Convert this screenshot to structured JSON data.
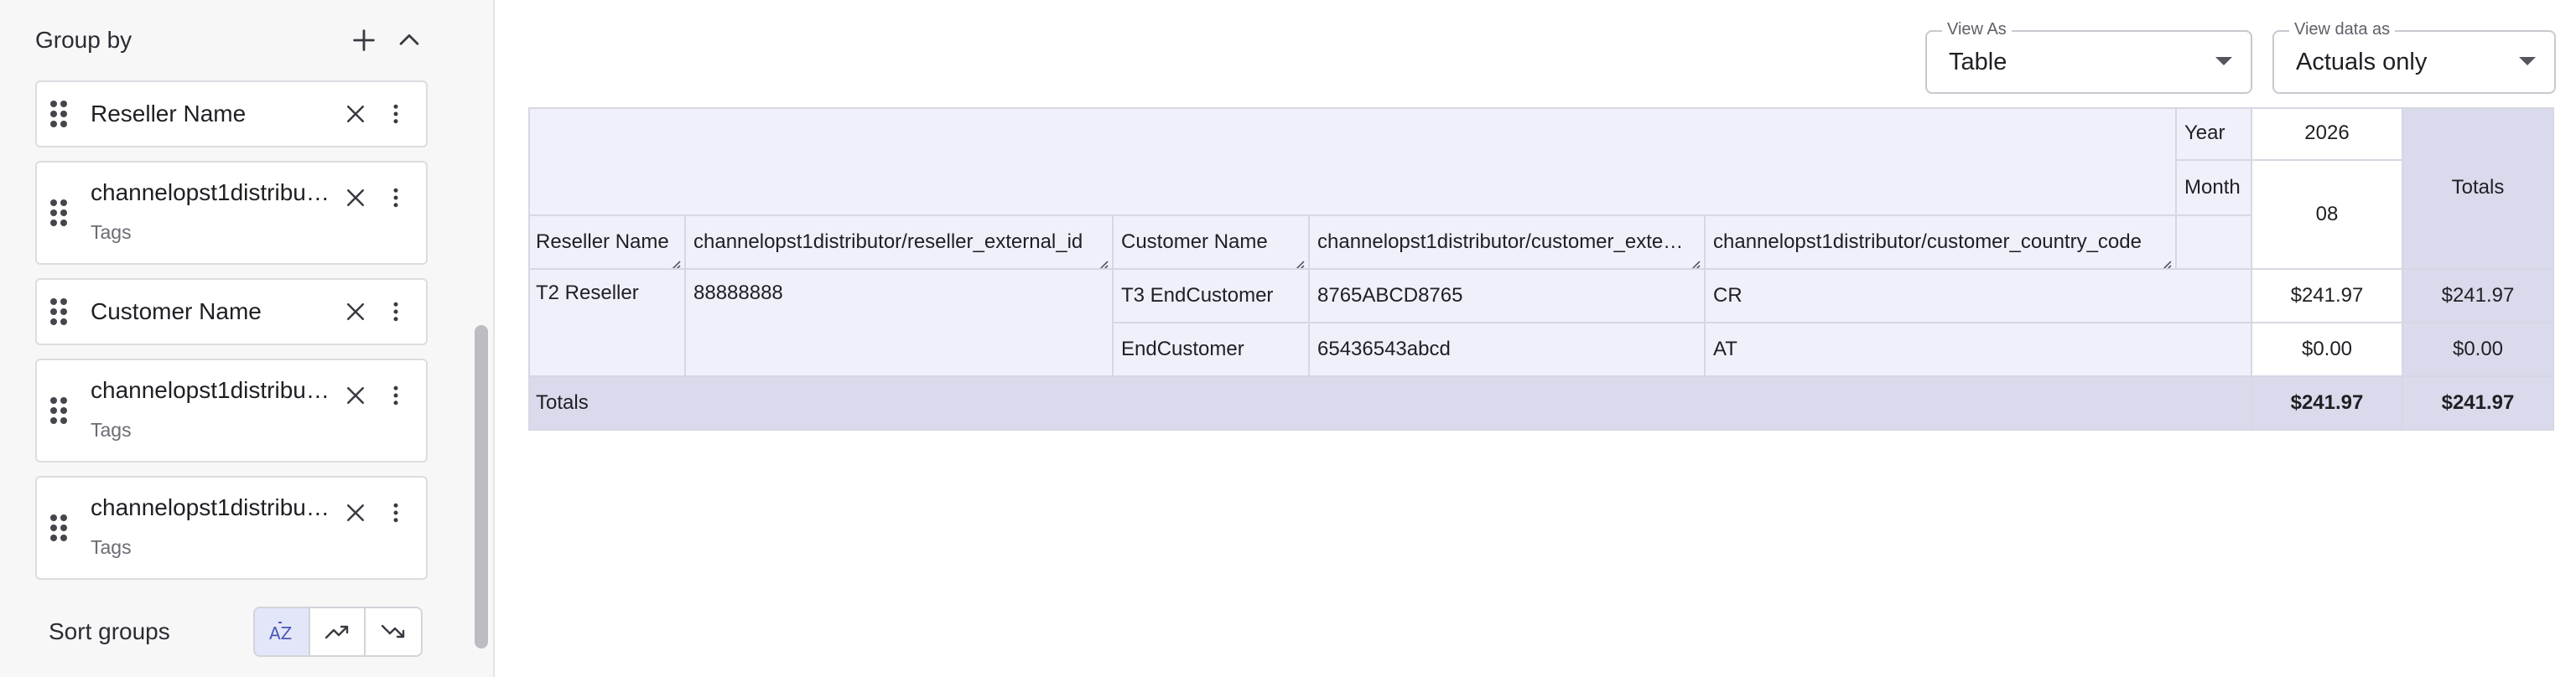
{
  "group_by": {
    "title": "Group by",
    "items": [
      {
        "label": "Reseller Name",
        "sub": ""
      },
      {
        "label": "channelopst1distributor/reseller_external_id",
        "sub": "Tags"
      },
      {
        "label": "Customer Name",
        "sub": ""
      },
      {
        "label": "channelopst1distributor/customer_external_id",
        "sub": "Tags"
      },
      {
        "label": "channelopst1distributor/customer_country_code",
        "sub": "Tags"
      }
    ]
  },
  "sort_groups": {
    "label": "Sort groups"
  },
  "view_as": {
    "legend": "View As",
    "value": "Table"
  },
  "view_data_as": {
    "legend": "View data as",
    "value": "Actuals only"
  },
  "table": {
    "year_label": "Year",
    "year_value": "2026",
    "month_label": "Month",
    "month_value": "08",
    "totals_header": "Totals",
    "columns": [
      "Reseller Name",
      "channelopst1distributor/reseller_external_id",
      "Customer Name",
      "channelopst1distributor/customer_external_id",
      "channelopst1distributor/customer_country_code"
    ],
    "reseller": "T2 Reseller",
    "reseller_external_id": "88888888",
    "rows": [
      {
        "customer": "T3 EndCustomer",
        "external_id": "8765ABCD8765",
        "country": "CR",
        "value": "$241.97",
        "total": "$241.97"
      },
      {
        "customer": "EndCustomer",
        "external_id": "65436543abcd",
        "country": "AT",
        "value": "$0.00",
        "total": "$0.00"
      }
    ],
    "totals_row": {
      "label": "Totals",
      "value": "$241.97",
      "total": "$241.97"
    }
  },
  "colors": {
    "accent": "#4c57b8",
    "header_bg": "#eff0fa",
    "totals_bg": "#d9dbec"
  }
}
